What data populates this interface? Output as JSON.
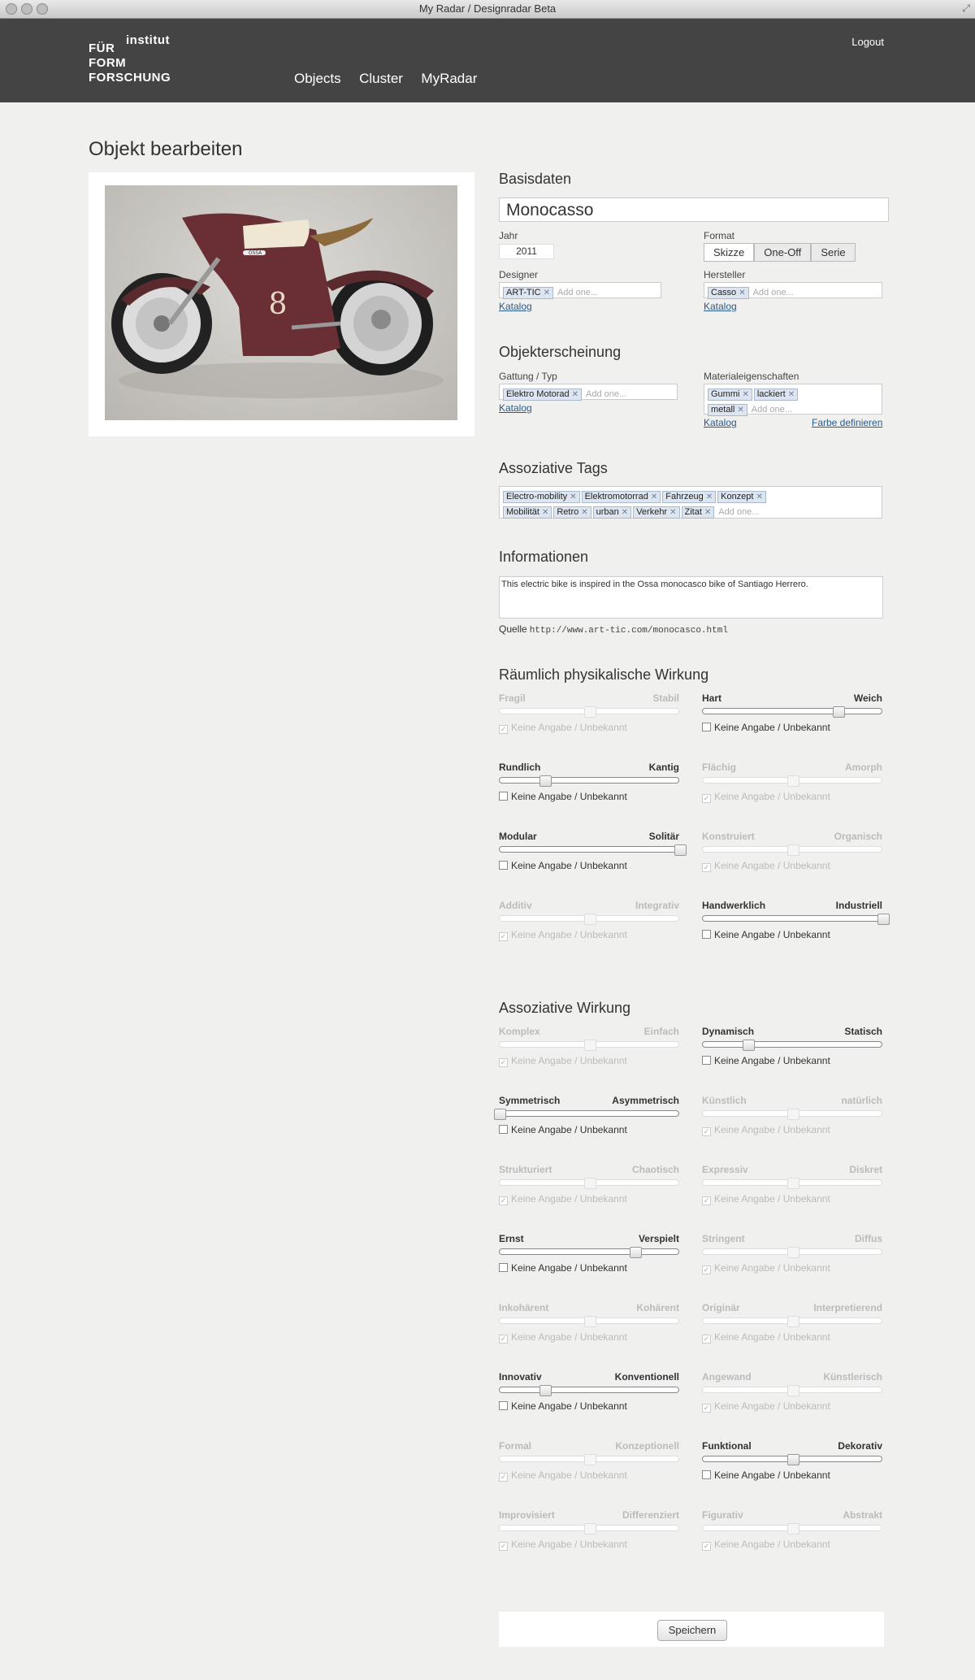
{
  "window": {
    "title": "My Radar / Designradar Beta"
  },
  "header": {
    "logo": {
      "line0": "institut",
      "line1": "FÜR",
      "line2": "FORM",
      "line3": "FORSCHUNG"
    },
    "nav": [
      "Objects",
      "Cluster",
      "MyRadar"
    ],
    "logout": "Logout"
  },
  "page": {
    "title": "Objekt bearbeiten"
  },
  "basisdaten": {
    "heading": "Basisdaten",
    "name": "Monocasso",
    "jahr_label": "Jahr",
    "jahr": "2011",
    "format_label": "Format",
    "format_options": [
      "Skizze",
      "One-Off",
      "Serie"
    ],
    "format_selected": "Skizze",
    "designer_label": "Designer",
    "designer_tags": [
      "ART-TIC"
    ],
    "hersteller_label": "Hersteller",
    "hersteller_tags": [
      "Casso"
    ],
    "add_placeholder": "Add one...",
    "katalog": "Katalog"
  },
  "erscheinung": {
    "heading": "Objekterscheinung",
    "gattung_label": "Gattung / Typ",
    "gattung_tags": [
      "Elektro Motorad"
    ],
    "material_label": "Materialeigenschaften",
    "material_tags": [
      "Gummi",
      "lackiert",
      "metall"
    ],
    "farbe": "Farbe definieren"
  },
  "tags": {
    "heading": "Assoziative Tags",
    "items": [
      "Electro-mobility",
      "Elektromotorrad",
      "Fahrzeug",
      "Konzept",
      "Mobilität",
      "Retro",
      "urban",
      "Verkehr",
      "Zitat"
    ]
  },
  "info": {
    "heading": "Informationen",
    "text": "This electric bike is inspired in the Ossa monocasco bike of Santiago Herrero.",
    "quelle_label": "Quelle",
    "quelle": "http://www.art-tic.com/monocasco.html"
  },
  "unknown_label": "Keine Angabe / Unbekannt",
  "physical": {
    "heading": "Räumlich physikalische Wirkung",
    "sliders": [
      {
        "left": "Fragil",
        "right": "Stabil",
        "value": 0.5,
        "unknown": true
      },
      {
        "left": "Hart",
        "right": "Weich",
        "value": 0.75,
        "unknown": false
      },
      {
        "left": "Rundlich",
        "right": "Kantig",
        "value": 0.25,
        "unknown": false
      },
      {
        "left": "Flächig",
        "right": "Amorph",
        "value": 0.5,
        "unknown": true
      },
      {
        "left": "Modular",
        "right": "Solitär",
        "value": 1.0,
        "unknown": false
      },
      {
        "left": "Konstruiert",
        "right": "Organisch",
        "value": 0.5,
        "unknown": true
      },
      {
        "left": "Additiv",
        "right": "Integrativ",
        "value": 0.5,
        "unknown": true
      },
      {
        "left": "Handwerklich",
        "right": "Industriell",
        "value": 1.0,
        "unknown": false
      }
    ]
  },
  "associative": {
    "heading": "Assoziative Wirkung",
    "sliders": [
      {
        "left": "Komplex",
        "right": "Einfach",
        "value": 0.5,
        "unknown": true
      },
      {
        "left": "Dynamisch",
        "right": "Statisch",
        "value": 0.25,
        "unknown": false
      },
      {
        "left": "Symmetrisch",
        "right": "Asymmetrisch",
        "value": 0.0,
        "unknown": false
      },
      {
        "left": "Künstlich",
        "right": "natürlich",
        "value": 0.5,
        "unknown": true
      },
      {
        "left": "Strukturiert",
        "right": "Chaotisch",
        "value": 0.5,
        "unknown": true
      },
      {
        "left": "Expressiv",
        "right": "Diskret",
        "value": 0.5,
        "unknown": true
      },
      {
        "left": "Ernst",
        "right": "Verspielt",
        "value": 0.75,
        "unknown": false
      },
      {
        "left": "Stringent",
        "right": "Diffus",
        "value": 0.5,
        "unknown": true
      },
      {
        "left": "Inkohärent",
        "right": "Kohärent",
        "value": 0.5,
        "unknown": true
      },
      {
        "left": "Originär",
        "right": "Interpretierend",
        "value": 0.5,
        "unknown": true
      },
      {
        "left": "Innovativ",
        "right": "Konventionell",
        "value": 0.25,
        "unknown": false
      },
      {
        "left": "Angewand",
        "right": "Künstlerisch",
        "value": 0.5,
        "unknown": true
      },
      {
        "left": "Formal",
        "right": "Konzeptionell",
        "value": 0.5,
        "unknown": true
      },
      {
        "left": "Funktional",
        "right": "Dekorativ",
        "value": 0.5,
        "unknown": false
      },
      {
        "left": "Improvisiert",
        "right": "Differenziert",
        "value": 0.5,
        "unknown": true
      },
      {
        "left": "Figurativ",
        "right": "Abstrakt",
        "value": 0.5,
        "unknown": true
      }
    ]
  },
  "save": "Speichern",
  "image": {
    "tank_number": "8",
    "badge": "OSSA"
  }
}
